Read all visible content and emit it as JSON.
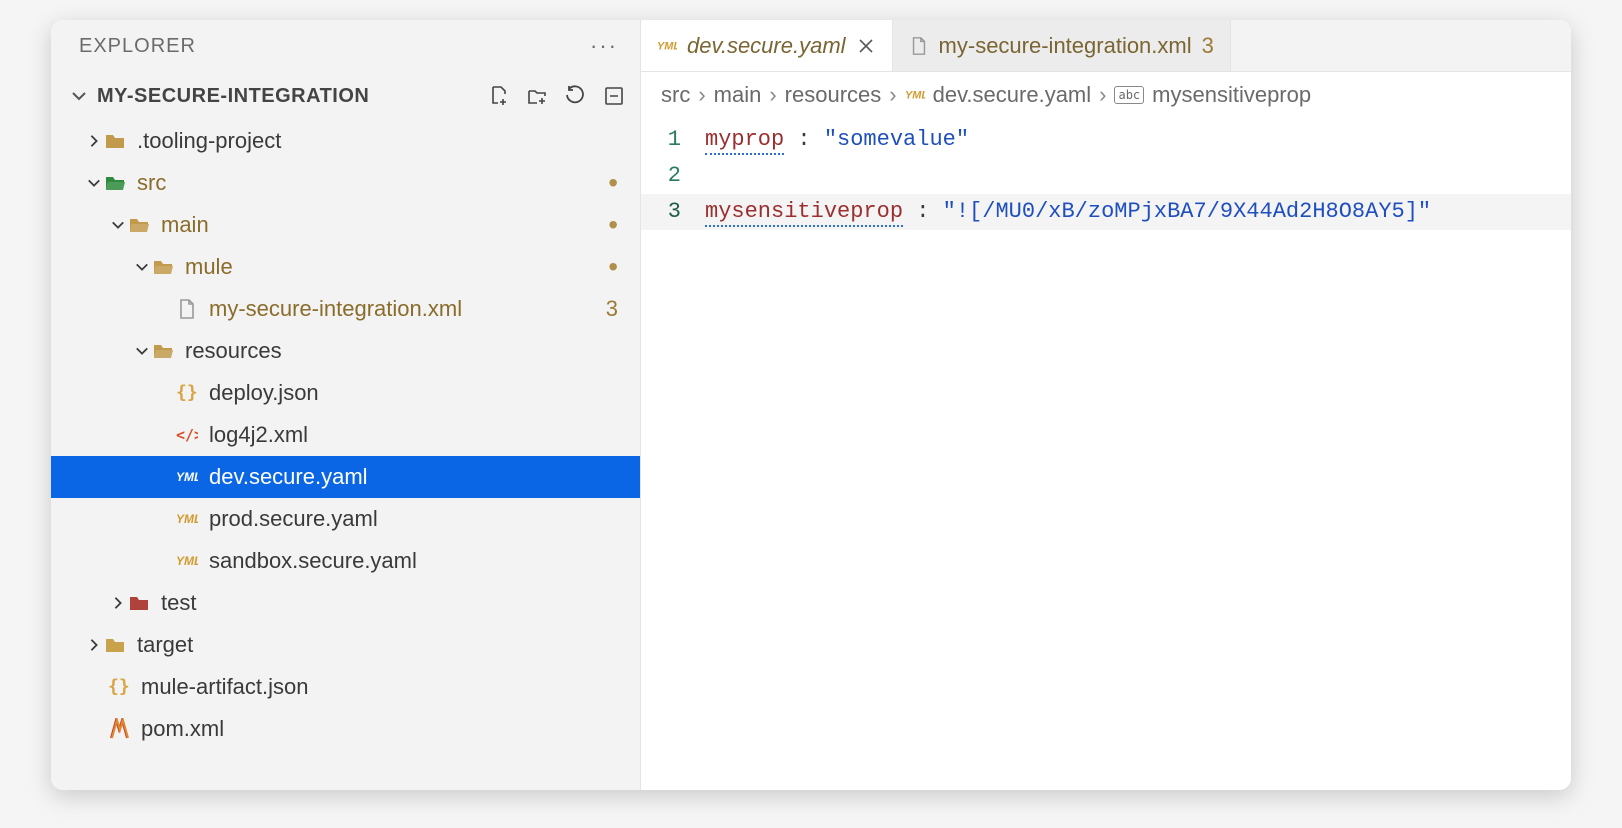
{
  "explorer": {
    "title": "EXPLORER"
  },
  "project": {
    "name": "MY-SECURE-INTEGRATION"
  },
  "tree": {
    "tooling": {
      "label": ".tooling-project"
    },
    "src": {
      "label": "src"
    },
    "main": {
      "label": "main"
    },
    "mule": {
      "label": "mule"
    },
    "mulefile": {
      "label": "my-secure-integration.xml",
      "badge": "3"
    },
    "resources": {
      "label": "resources"
    },
    "deploy": {
      "label": "deploy.json"
    },
    "log4j2": {
      "label": "log4j2.xml"
    },
    "dev": {
      "label": "dev.secure.yaml"
    },
    "prod": {
      "label": "prod.secure.yaml"
    },
    "sandbox": {
      "label": "sandbox.secure.yaml"
    },
    "test": {
      "label": "test"
    },
    "target": {
      "label": "target"
    },
    "muleart": {
      "label": "mule-artifact.json"
    },
    "pom": {
      "label": "pom.xml"
    }
  },
  "tabs": [
    {
      "label": "dev.secure.yaml",
      "active": true
    },
    {
      "label": "my-secure-integration.xml",
      "badge": "3"
    }
  ],
  "breadcrumb": {
    "parts": [
      "src",
      "main",
      "resources",
      "dev.secure.yaml",
      "mysensitiveprop"
    ]
  },
  "code": {
    "lines": {
      "l1": {
        "num": "1",
        "key": "myprop",
        "sep": " : ",
        "value": "\"somevalue\""
      },
      "l2": {
        "num": "2"
      },
      "l3": {
        "num": "3",
        "key": "mysensitiveprop",
        "sep": " : ",
        "value": "\"![/MU0/xB/zoMPjxBA7/9X44Ad2H8O8AY5]\""
      }
    }
  }
}
